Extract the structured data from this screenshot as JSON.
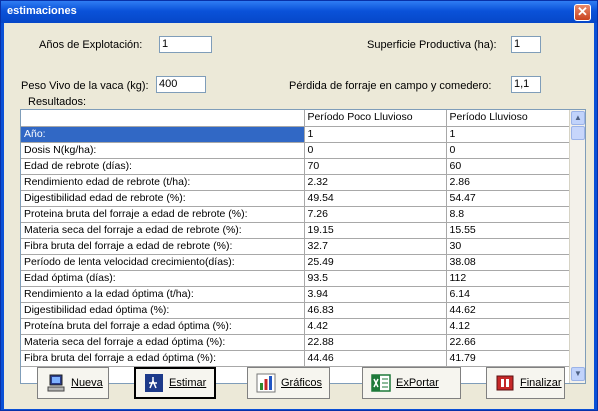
{
  "window": {
    "title": "estimaciones",
    "close_glyph": "✕"
  },
  "form": {
    "anios_label": "Años de Explotación:",
    "anios_value": "1",
    "superficie_label": "Superficie Productiva (ha):",
    "superficie_value": "1",
    "peso_label": "Peso Vivo de la vaca (kg):",
    "peso_value": "400",
    "perdida_label": "Pérdida de forraje en campo y comedero:",
    "perdida_value": "1,1",
    "resultados_label": "Resultados:"
  },
  "grid": {
    "columns": [
      "",
      "Período Poco Lluvioso",
      "Período Lluvioso"
    ],
    "rows": [
      [
        "Año:",
        "1",
        "1"
      ],
      [
        "Dosis N(kg/ha):",
        "0",
        "0"
      ],
      [
        "Edad de rebrote (días):",
        "70",
        "60"
      ],
      [
        "Rendimiento edad de rebrote (t/ha):",
        "2.32",
        "2.86"
      ],
      [
        "Digestibilidad edad de rebrote (%):",
        "49.54",
        "54.47"
      ],
      [
        "Proteina bruta del forraje a edad de rebrote (%):",
        "7.26",
        "8.8"
      ],
      [
        "Materia seca del forraje a edad de rebrote (%):",
        "19.15",
        "15.55"
      ],
      [
        "Fibra bruta del forraje a edad de rebrote (%):",
        "32.7",
        "30"
      ],
      [
        "Período de lenta velocidad crecimiento(días):",
        "25.49",
        "38.08"
      ],
      [
        "Edad óptima (días):",
        "93.5",
        "112"
      ],
      [
        "Rendimiento a la edad óptima (t/ha):",
        "3.94",
        "6.14"
      ],
      [
        "Digestibilidad edad óptima (%):",
        "46.83",
        "44.62"
      ],
      [
        "Proteína bruta del forraje a edad óptima (%):",
        "4.42",
        "4.12"
      ],
      [
        "Materia seca del forraje a edad óptima (%):",
        "22.88",
        "22.66"
      ],
      [
        "Fibra bruta del forraje a edad óptima (%):",
        "44.46",
        "41.79"
      ]
    ]
  },
  "buttons": {
    "nueva": "Nueva",
    "estimar": "Estimar",
    "graficos": "Gráficos",
    "exportar": "ExPortar",
    "finalizar": "Finalizar"
  },
  "scrollbar": {
    "up_glyph": "▲",
    "down_glyph": "▼"
  }
}
